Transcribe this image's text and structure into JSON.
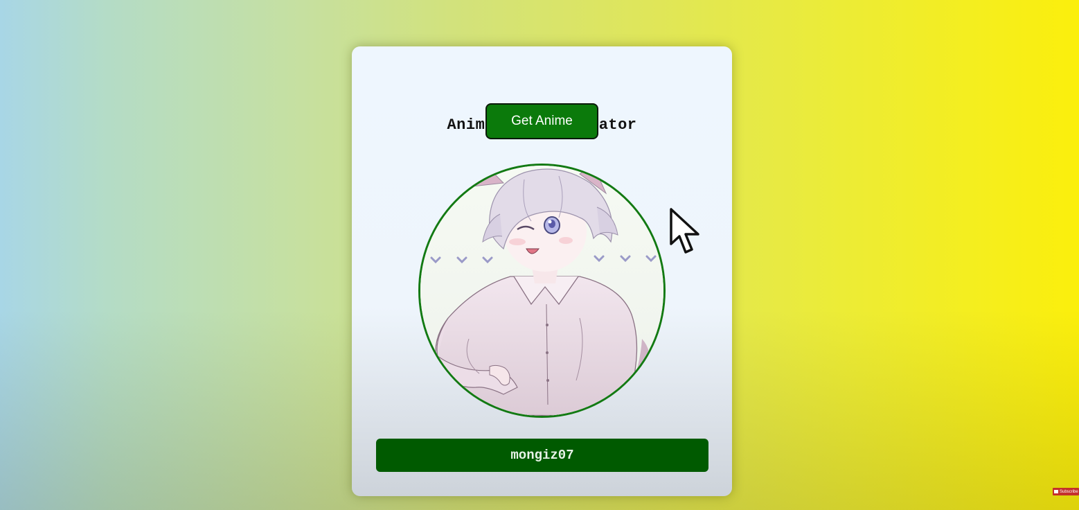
{
  "app": {
    "title": "Anime Pics Generator",
    "get_button_label": "Get Anime",
    "username": "mongiz07",
    "image_alt": "anime-character-image"
  },
  "overlay": {
    "subscribe_label": "Subscribe"
  },
  "colors": {
    "button_green": "#0b7a0b",
    "name_bar_green": "#005a00",
    "frame_border": "#137a13",
    "bg_left": "#a8d6e6",
    "bg_right": "#fbef0c"
  }
}
